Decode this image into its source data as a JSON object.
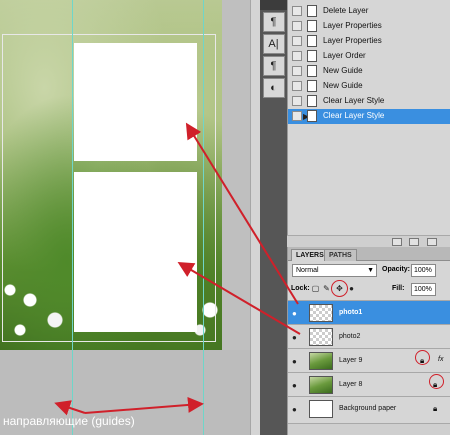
{
  "caption": "направляющие (guides)",
  "history": {
    "items": [
      {
        "label": "Delete Layer"
      },
      {
        "label": "Layer Properties"
      },
      {
        "label": "Layer Properties"
      },
      {
        "label": "Layer Order"
      },
      {
        "label": "New Guide"
      },
      {
        "label": "New Guide"
      },
      {
        "label": "Clear Layer Style"
      },
      {
        "label": "Clear Layer Style",
        "active": true
      }
    ]
  },
  "tools": {
    "icons": [
      "paragraph-style-icon",
      "character-icon",
      "paragraph-icon",
      "brush-icon"
    ]
  },
  "layers_panel": {
    "tabs": [
      "LAYERS",
      "PATHS"
    ],
    "blend_mode": "Normal",
    "opacity_label": "Opacity:",
    "opacity_value": "100%",
    "lock_label": "Lock:",
    "fill_label": "Fill:",
    "fill_value": "100%",
    "layers": [
      {
        "name": "photo1",
        "selected": true,
        "thumb": "transparent"
      },
      {
        "name": "photo2",
        "selected": false,
        "thumb": "transparent"
      },
      {
        "name": "Layer 9",
        "selected": false,
        "thumb": "photo",
        "locked": true,
        "fx": true
      },
      {
        "name": "Layer 8",
        "selected": false,
        "thumb": "photo",
        "locked": true
      },
      {
        "name": "Background paper",
        "selected": false,
        "thumb": "white",
        "locked": true
      }
    ]
  },
  "colors": {
    "selection_blue": "#3a8fe0",
    "annotation_red": "#d0202a",
    "guide_cyan": "#6fd6c9"
  }
}
